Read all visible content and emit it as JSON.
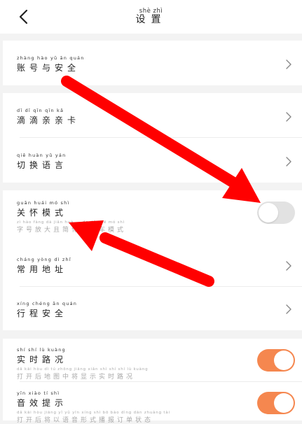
{
  "header": {
    "title_pinyin": "shè  zhì",
    "title": "设置"
  },
  "rows": [
    {
      "pinyin": "zhàng hào  yǔ  ān  quán",
      "label": "账号与安全"
    },
    {
      "pinyin": "dī  dī  qīn  qīn  kǎ",
      "label": "滴滴亲亲卡"
    },
    {
      "pinyin": "qiē huàn  yǔ  yán",
      "label": "切换语言"
    },
    {
      "pinyin": "guān huái  mó  shì",
      "label": "关怀模式",
      "desc_pinyin": "zì  hào fàng dà  jiǎn huà    ...    de  dǎ  chē  mó  shì",
      "desc": "字号放大且简化的打车模式"
    },
    {
      "pinyin": "cháng yòng  dì  zhǐ",
      "label": "常用地址"
    },
    {
      "pinyin": "xíng chéng  ān  quán",
      "label": "行程安全"
    },
    {
      "pinyin": "shí  shí  lù  kuàng",
      "label": "实时路况",
      "desc_pinyin": "dǎ  kāi  hòu  dì  tú  zhōng jiāng xiǎn  shì  shí  shí  lù  kuàng",
      "desc": "打开后地图中将显示实时路况"
    },
    {
      "pinyin": "yīn  xiào  tí  shì",
      "label": "音效提示",
      "desc_pinyin": "dǎ  kāi  hòu  jiāng  yǐ  yǔ  yīn  xíng  shì  bō  bào  dìng  dān  zhuàng  tài",
      "desc": "打开后将以语音形式播报订单状态"
    }
  ],
  "toggles": {
    "care_mode": "off",
    "realtime_traffic": "on",
    "sound_prompt": "on"
  },
  "colors": {
    "toggle_on": "#f5874f",
    "toggle_off": "#e2e2e2",
    "arrow": "#ff0000"
  }
}
